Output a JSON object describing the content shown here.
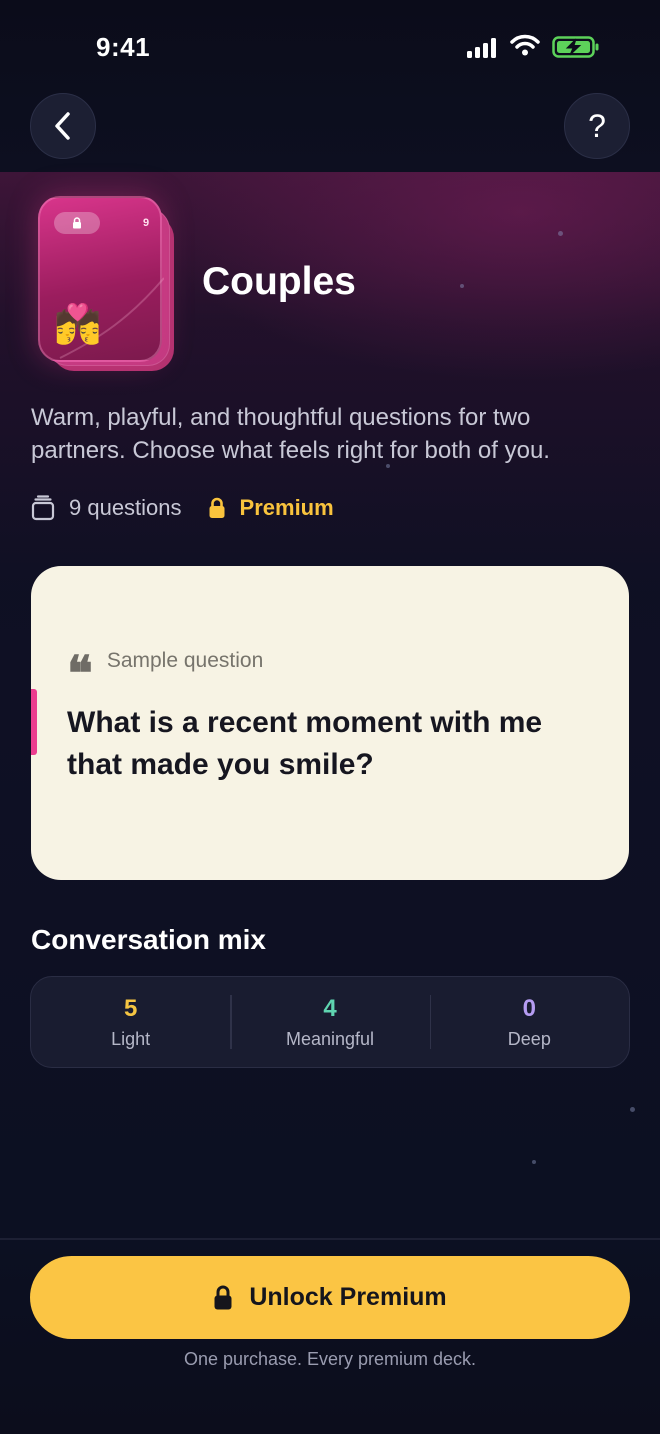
{
  "status_bar": {
    "time": "9:41"
  },
  "nav": {
    "back_icon": "chevron-left-icon",
    "help_label": "?"
  },
  "deck": {
    "title": "Couples",
    "card_count": "9",
    "emoji": "💏",
    "lock_icon": "lock-icon",
    "accent_color": "#d8358b",
    "description": "Warm, playful, and thoughtful questions for two partners. Choose what feels right for both of you.",
    "questions_label": "9 questions",
    "premium_label": "Premium"
  },
  "sample": {
    "label": "Sample question",
    "question": "What is a recent moment with me that made you smile?"
  },
  "mix": {
    "title": "Conversation mix",
    "items": [
      {
        "value": "5",
        "label": "Light",
        "color": "#f5c542"
      },
      {
        "value": "4",
        "label": "Meaningful",
        "color": "#5fd4b0"
      },
      {
        "value": "0",
        "label": "Deep",
        "color": "#b59cf2"
      }
    ]
  },
  "footer": {
    "unlock_label": "Unlock Premium",
    "note": "One purchase. Every premium deck.",
    "button_color": "#fbc544"
  }
}
